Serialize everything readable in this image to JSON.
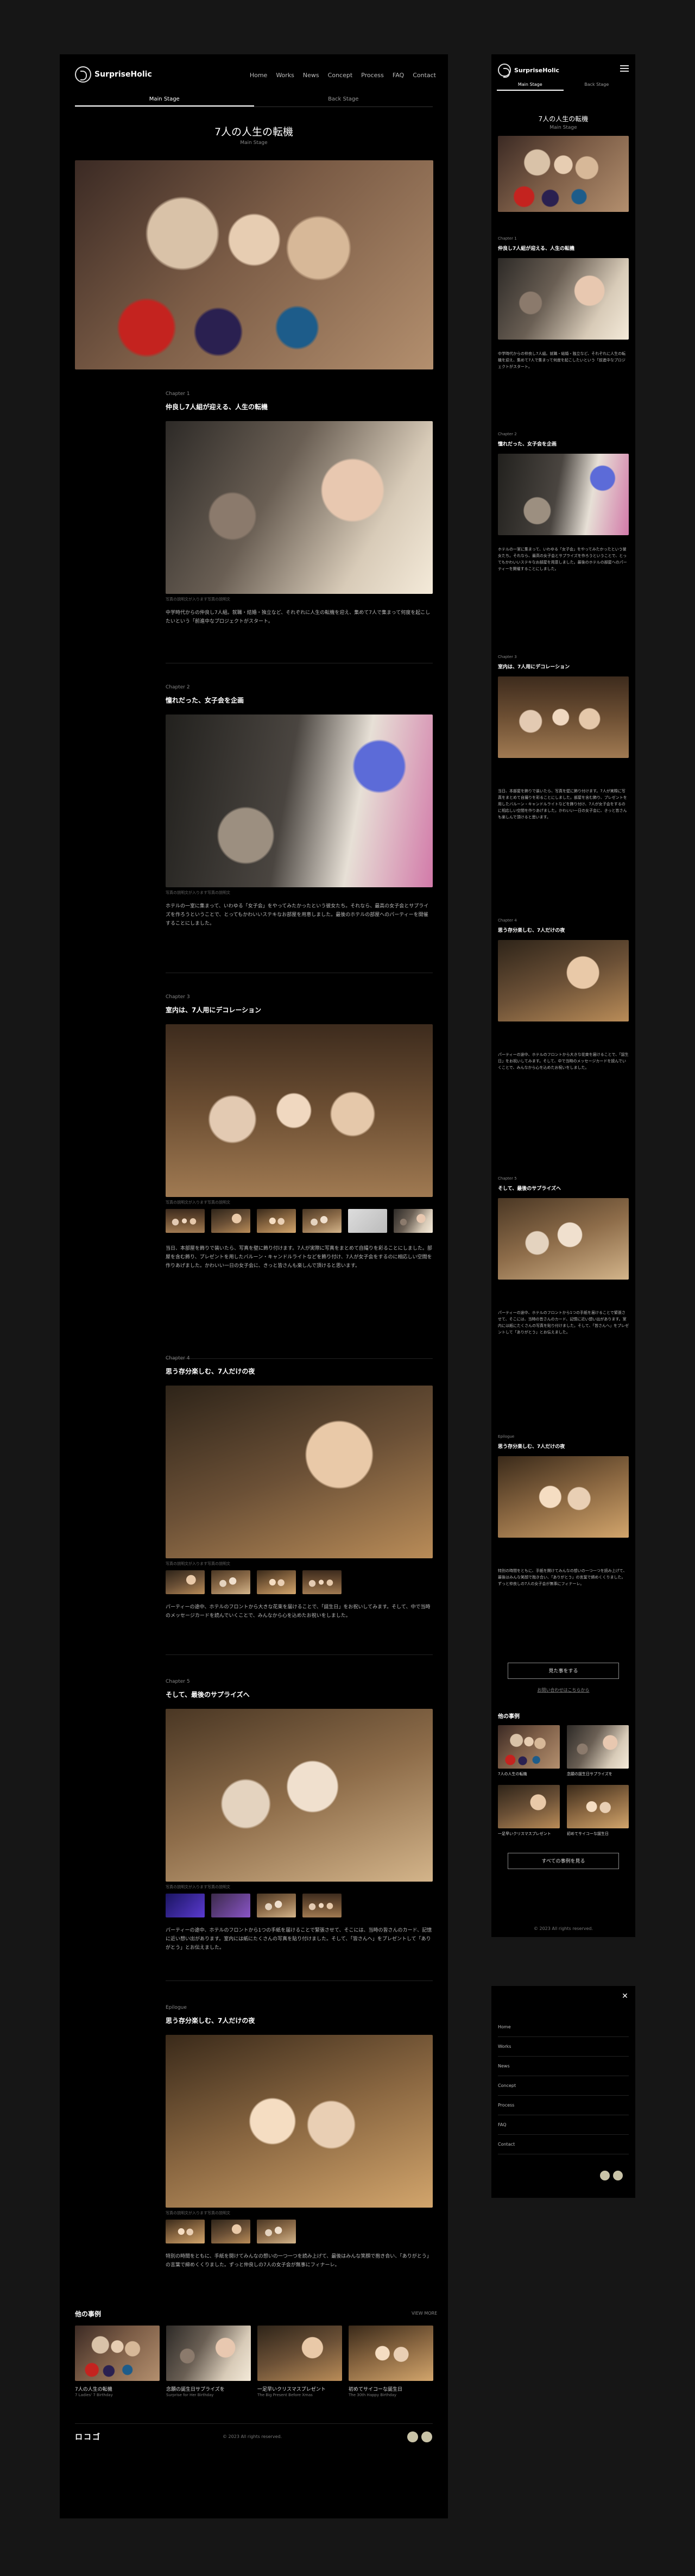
{
  "site": {
    "brand": "SurpriseHolic"
  },
  "nav": {
    "items": [
      "Home",
      "Works",
      "News",
      "Concept",
      "Process",
      "FAQ",
      "Contact"
    ]
  },
  "stage": {
    "main": "Main Stage",
    "back": "Back Stage"
  },
  "story": {
    "title": "7人の人生の転機",
    "subtitle": "Main Stage",
    "chapters": [
      {
        "label": "Chapter 1",
        "heading": "仲良し7人組が迎える、人生の転機",
        "caption": "写真の説明文が入ります写真の説明文",
        "body": "中学時代からの仲良し7人組。就職・結婚・独立など、それぞれに人生の転機を迎え、集めて7人で集まって何度を起こしたいという「前進中なプロジェクトがスタート。"
      },
      {
        "label": "Chapter 2",
        "heading": "憧れだった、女子会を企画",
        "caption": "写真の説明文が入ります写真の説明文",
        "body": "ホテルの一室に集まって、いわゆる「女子会」をやってみたかったという彼女たち。それなら、最高の女子会とサプライズを作ろうということで、とってもかわいいステキなお部屋を用意しました。最後のホテルの部屋へのパーティーを開催することにしました。"
      },
      {
        "label": "Chapter 3",
        "heading": "室内は、7人用にデコレーション",
        "caption": "写真の説明文が入ります写真の説明文",
        "body": "当日、本部屋を飾りで装いたら、写真を壁に飾り付けます。7人が実際に写真をまとめて自撮りを彩ることにしました。部屋を含む飾り、プレゼントを用したバルーン・キャンドルライトなどを飾り付け、7人が女子会をするのに相応しい空間を作りあげました。かわいい一日の女子会に、きっと皆さんも楽しんで頂けると思います。"
      },
      {
        "label": "Chapter 4",
        "heading": "思う存分楽しむ、7人だけの夜",
        "caption": "写真の説明文が入ります写真の説明文",
        "body": "パーティーの途中、ホテルのフロントから大きな花束を届けることで、「誕生日」をお祝いしてみます。そして、中で当時のメッセージカードを読んでいくことで、みんなから心を込めたお祝いをしました。"
      },
      {
        "label": "Chapter 5",
        "heading": "そして、最後のサプライズへ",
        "caption": "写真の説明文が入ります写真の説明文",
        "body": "パーティーの途中、ホテルのフロントから1つの手紙を届けることで緊張させて、そこには、当時の皆さんのカード、記憶に近い想い出があります。室内には紙にたくさんの写真を貼り付けました。そして、「皆さんへ」をプレゼントして「ありがとう」とお伝えました。"
      },
      {
        "label": "Epilogue",
        "heading": "思う存分楽しむ、7人だけの夜",
        "caption": "写真の説明文が入ります写真の説明文",
        "body": "特別の時間をともに、手紙を開けてみんなの想いの一つ一つを読み上げて、最後はみんな笑顔で抱き合い、「ありがとう」の言葉で締めくくりました。ずっと仲良しの7人の女子会が無事にフィナーレ。"
      }
    ]
  },
  "related": {
    "title": "他の事例",
    "more": "VIEW MORE",
    "items": [
      {
        "title": "7人の人生の転機",
        "sub": "7 Ladies' 7 Birthday"
      },
      {
        "title": "念願の誕生日サプライズを",
        "sub": "Surprise for Her Birthday"
      },
      {
        "title": "一足早いクリスマスプレゼント",
        "sub": "The Big Present Before Xmas"
      },
      {
        "title": "初めてサイコーな誕生日",
        "sub": "The 30th Happy Birthday"
      }
    ]
  },
  "mobile": {
    "btn_request": "見た事をする",
    "btn_contact": "お問い合わせはこちらから",
    "btn_more": "すべての事例を見る",
    "menu_items": [
      "Home",
      "Works",
      "News",
      "Concept",
      "Process",
      "FAQ",
      "Contact"
    ]
  },
  "footer": {
    "logo": "ロコゴ",
    "copyright": "© 2023 All rights reserved."
  }
}
